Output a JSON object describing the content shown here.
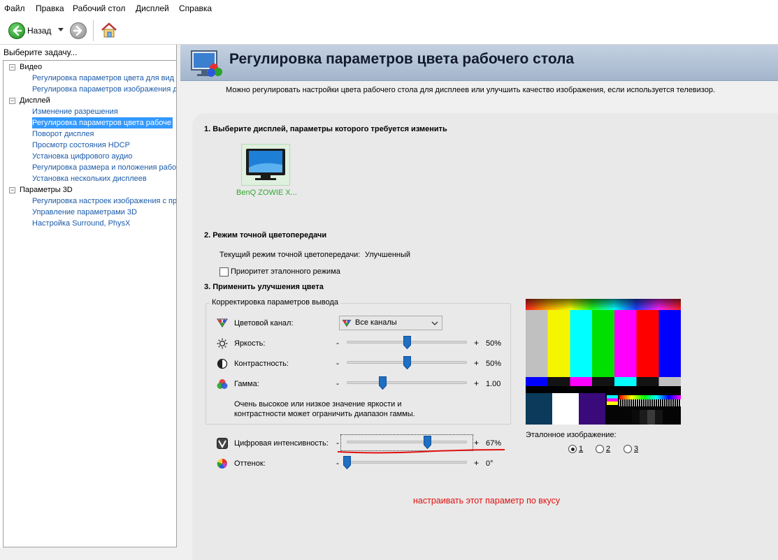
{
  "menu": [
    "Файл",
    "Правка",
    "Рабочий стол",
    "Дисплей",
    "Справка"
  ],
  "toolbar": {
    "back_label": "Назад"
  },
  "sidebar": {
    "task_label": "Выберите задачу...",
    "categories": [
      {
        "label": "Видео",
        "items": [
          "Регулировка параметров цвета для вид",
          "Регулировка параметров изображения д"
        ]
      },
      {
        "label": "Дисплей",
        "items": [
          "Изменение разрешения",
          "Регулировка параметров цвета рабоче",
          "Поворот дисплея",
          "Просмотр состояния HDCP",
          "Установка цифрового аудио",
          "Регулировка размера и положения рабо",
          "Установка нескольких дисплеев"
        ]
      },
      {
        "label": "Параметры 3D",
        "items": [
          "Регулировка настроек изображения с пр",
          "Управление параметрами 3D",
          "Настройка Surround, PhysX"
        ]
      }
    ],
    "selected_item": "Регулировка параметров цвета рабоче"
  },
  "header": {
    "title": "Регулировка параметров цвета рабочего стола",
    "description": "Можно регулировать настройки цвета рабочего стола для дисплеев или улучшить качество изображения, если используется телевизор."
  },
  "section1": {
    "heading": "1. Выберите дисплей, параметры которого требуется изменить",
    "display_name": "BenQ ZOWIE X..."
  },
  "section2": {
    "heading": "2. Режим точной цветопередачи",
    "current_mode_label": "Текущий режим точной цветопередачи:",
    "current_mode_value": "Улучшенный",
    "reference_priority_label": "Приоритет эталонного режима",
    "reference_priority_checked": false
  },
  "section3": {
    "heading": "3. Применить улучшения цвета",
    "group_title": "Корректировка параметров вывода",
    "color_channel": {
      "label": "Цветовой канал:",
      "value": "Все каналы"
    },
    "brightness": {
      "label": "Яркость:",
      "value_text": "50%",
      "value": 0.5
    },
    "contrast": {
      "label": "Контрастность:",
      "value_text": "50%",
      "value": 0.5
    },
    "gamma": {
      "label": "Гамма:",
      "value_text": "1.00",
      "value": 0.3
    },
    "note": [
      "Очень высокое или низкое значение яркости и",
      "контрастности может ограничить диапазон гаммы."
    ],
    "digital_vibrance": {
      "label": "Цифровая интенсивность:",
      "value_text": "67%",
      "value": 0.67
    },
    "hue": {
      "label": "Оттенок:",
      "value_text": "0°",
      "value": 0.0
    },
    "reference_image": {
      "label": "Эталонное изображение:",
      "options": [
        "1",
        "2",
        "3"
      ],
      "selected": "1"
    }
  },
  "annotation": {
    "text": "настраивать этот параметр по вкусу",
    "color": "#e01010"
  },
  "colors": {
    "link": "#1a5aa8",
    "selection": "#3399ff",
    "header_bg": "#b5c5d8",
    "slider_thumb": "#1f6fc2",
    "green_label": "#2fa82f"
  }
}
